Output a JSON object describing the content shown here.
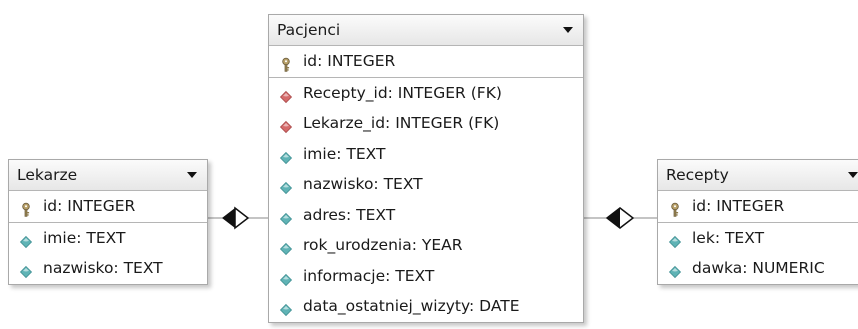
{
  "entities": {
    "lekarze": {
      "name": "Lekarze",
      "pk_fields": [
        {
          "label": "id: INTEGER",
          "icon": "key-icon"
        }
      ],
      "fields": [
        {
          "label": "imie: TEXT",
          "icon": "field-icon"
        },
        {
          "label": "nazwisko: TEXT",
          "icon": "field-icon"
        }
      ]
    },
    "pacjenci": {
      "name": "Pacjenci",
      "pk_fields": [
        {
          "label": "id: INTEGER",
          "icon": "key-icon"
        }
      ],
      "fields": [
        {
          "label": "Recepty_id: INTEGER (FK)",
          "icon": "foreign-key-icon"
        },
        {
          "label": "Lekarze_id: INTEGER (FK)",
          "icon": "foreign-key-icon"
        },
        {
          "label": "imie: TEXT",
          "icon": "field-icon"
        },
        {
          "label": "nazwisko: TEXT",
          "icon": "field-icon"
        },
        {
          "label": "adres: TEXT",
          "icon": "field-icon"
        },
        {
          "label": "rok_urodzenia: YEAR",
          "icon": "field-icon"
        },
        {
          "label": "informacje: TEXT",
          "icon": "field-icon"
        },
        {
          "label": "data_ostatniej_wizyty: DATE",
          "icon": "field-icon"
        }
      ]
    },
    "recepty": {
      "name": "Recepty",
      "pk_fields": [
        {
          "label": "id: INTEGER",
          "icon": "key-icon"
        }
      ],
      "fields": [
        {
          "label": "lek: TEXT",
          "icon": "field-icon"
        },
        {
          "label": "dawka: NUMERIC",
          "icon": "field-icon"
        }
      ]
    }
  },
  "relationships": [
    {
      "from": "Lekarze",
      "to": "Pacjenci",
      "end": "diamond"
    },
    {
      "from": "Recepty",
      "to": "Pacjenci",
      "end": "diamond"
    }
  ],
  "colors": {
    "field_icon": "#5fb3b5",
    "foreign_key_icon": "#d46a6a",
    "key_icon": "#b8a068"
  }
}
